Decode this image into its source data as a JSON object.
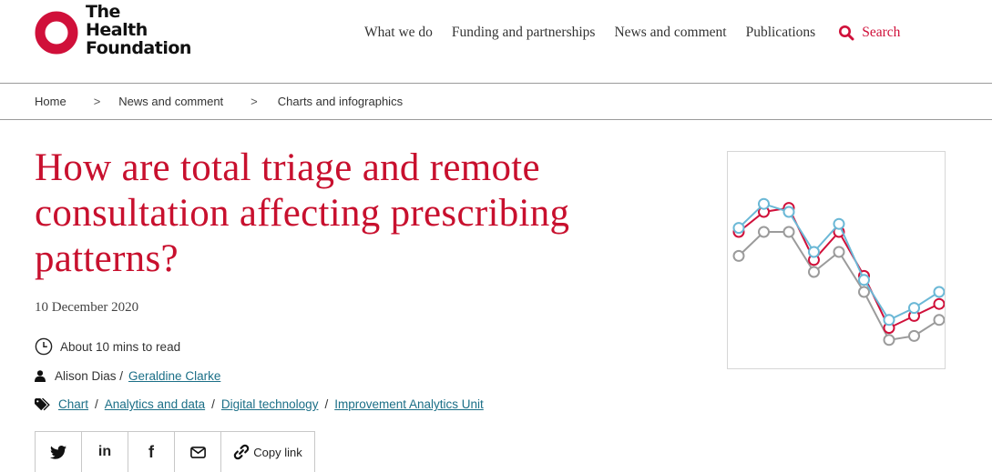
{
  "brand": {
    "line1": "The",
    "line2": "Health",
    "line3": "Foundation",
    "color": "#d0103a"
  },
  "nav": {
    "items": [
      "What we do",
      "Funding and partnerships",
      "News and comment",
      "Publications"
    ],
    "search_label": "Search",
    "search_icon": "search-icon"
  },
  "breadcrumb": {
    "items": [
      "Home",
      "News and comment",
      "Charts and infographics"
    ],
    "separator": ">"
  },
  "article": {
    "title": "How are total triage and remote consultation affecting prescribing patterns?",
    "date": "10 December 2020",
    "read_time": "About 10 mins to read",
    "author_plain": "Alison Dias /",
    "author_link": "Geraldine Clarke",
    "tags": [
      "Chart",
      "Analytics and data",
      "Digital technology",
      "Improvement Analytics Unit"
    ],
    "tag_separator": "/"
  },
  "share": {
    "twitter_icon": "twitter-icon",
    "linkedin_label": "in",
    "facebook_label": "f",
    "email_icon": "email-icon",
    "copy_label": "Copy link"
  },
  "thumbnail": {
    "description_icon": "line-chart-thumbnail",
    "colors": {
      "blue": "#6bb8d6",
      "red": "#d0103a",
      "grey": "#9b9b9b"
    },
    "series": [
      {
        "color_key": "blue",
        "values": [
          6.2,
          7.4,
          7.0,
          5.0,
          6.4,
          3.6,
          1.6,
          2.2,
          3.0
        ]
      },
      {
        "color_key": "red",
        "values": [
          6.0,
          7.0,
          7.2,
          4.6,
          6.0,
          3.8,
          1.2,
          1.8,
          2.4
        ]
      },
      {
        "color_key": "grey",
        "values": [
          4.8,
          6.0,
          6.0,
          4.0,
          5.0,
          3.0,
          0.6,
          0.8,
          1.6
        ]
      }
    ]
  }
}
